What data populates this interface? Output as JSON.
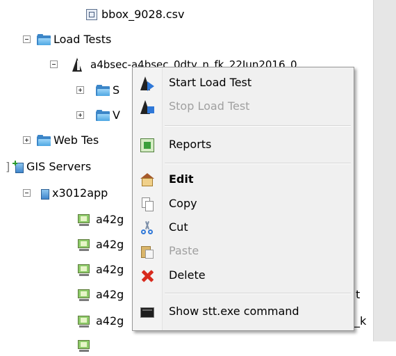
{
  "tree": {
    "csv_file": "bbox_9028.csv",
    "load_tests_label": "Load Tests",
    "load_test_item": "a4bsec-a4bsec_0dty_n_fk_22Jun2016_0",
    "sub1_partial": "S",
    "sub2_partial": "V",
    "web_tests_label": "Web Tes",
    "gis_servers_label": "GIS Servers",
    "gis_server_name": "x3012app",
    "machines": [
      "a42g",
      "a42g",
      "a42g",
      "a42g",
      "a42g"
    ],
    "tail_text_1": "t",
    "tail_text_2": "_k"
  },
  "context_menu": {
    "start": "Start Load Test",
    "stop": "Stop Load Test",
    "reports": "Reports",
    "edit": "Edit",
    "copy": "Copy",
    "cut": "Cut",
    "paste": "Paste",
    "delete": "Delete",
    "show_command": "Show stt.exe command"
  },
  "colors": {
    "folder_blue": "#3c86c8",
    "menu_bg": "#f0f0f0",
    "disabled_text": "#a0a0a0",
    "delete_red": "#d82b1e"
  }
}
